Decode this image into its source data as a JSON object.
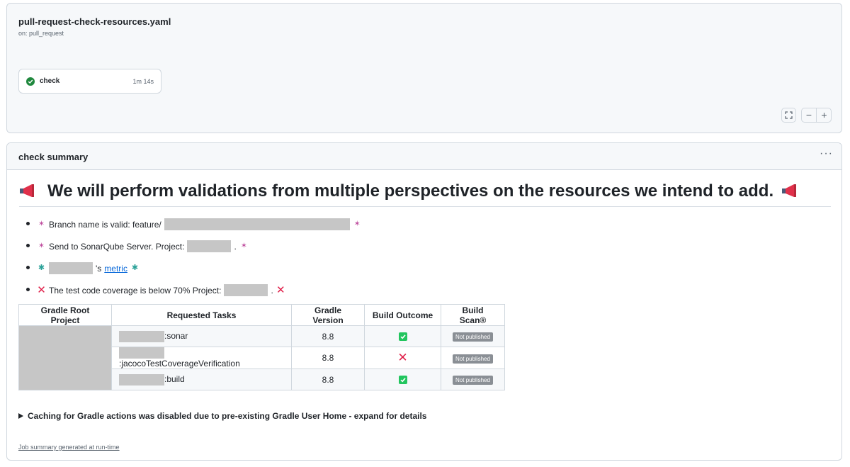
{
  "workflow": {
    "file_name": "pull-request-check-resources.yaml",
    "trigger": "on: pull_request",
    "job": {
      "name": "check",
      "duration": "1m 14s",
      "status": "success"
    },
    "zoom": {
      "fullscreen_icon": "fullscreen-icon",
      "minus": "−",
      "plus": "+"
    }
  },
  "summary": {
    "title": "check summary",
    "menu": "···",
    "heading": "We will perform validations from multiple perspectives on the resources we intend to add.",
    "bullets": {
      "branch_text": "Branch name is valid: feature/",
      "sonar_text": "Send to SonarQube Server. Project:",
      "sonar_suffix": ".",
      "metric_suffix": "'s",
      "metric_link": "metric",
      "coverage_text": "The test code coverage is below 70% Project:",
      "coverage_suffix": "."
    },
    "table": {
      "headers": [
        "Gradle Root Project",
        "Requested Tasks",
        "Gradle Version",
        "Build Outcome",
        "Build Scan®"
      ],
      "rows": [
        {
          "task": ":sonar",
          "version": "8.8",
          "outcome": "success",
          "scan": "Not published"
        },
        {
          "task": ":jacocoTestCoverageVerification",
          "version": "8.8",
          "outcome": "failure",
          "scan": "Not published"
        },
        {
          "task": ":build",
          "version": "8.8",
          "outcome": "success",
          "scan": "Not published"
        }
      ]
    },
    "details": "Caching for Gradle actions was disabled due to pre-existing Gradle User Home - expand for details",
    "footer": "Job summary generated at run-time"
  },
  "colors": {
    "success": "#1f883d",
    "failure": "#e0204a",
    "link": "#0969da",
    "redacted": "#c6c6c6"
  }
}
